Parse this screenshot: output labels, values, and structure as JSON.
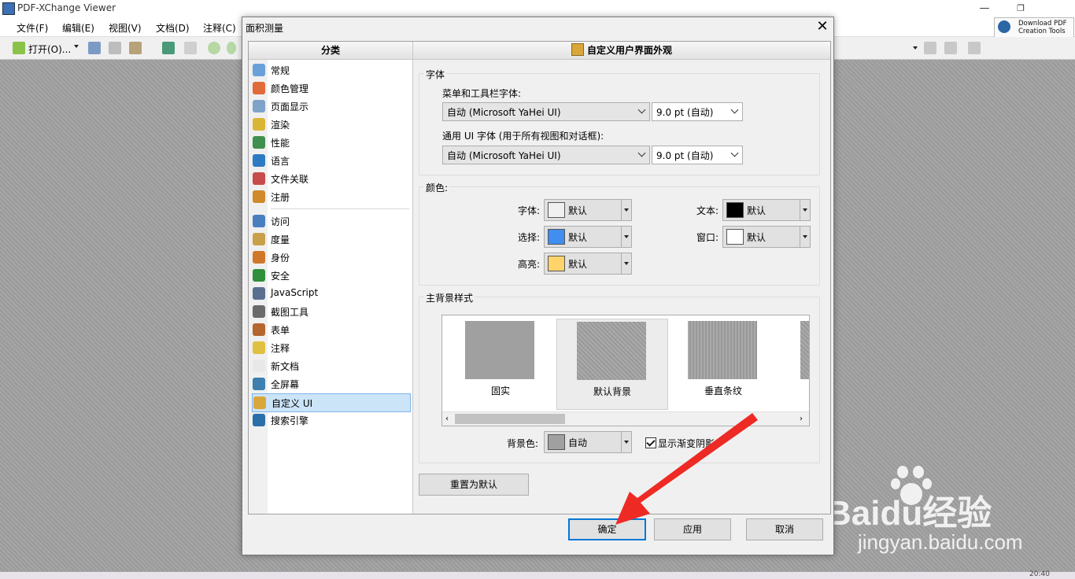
{
  "app": {
    "title": "PDF-XChange Viewer",
    "menus": [
      "文件(F)",
      "编辑(E)",
      "视图(V)",
      "文档(D)",
      "注释(C)"
    ],
    "toolbar_open": "打开(O)...",
    "download_tools": "Download PDF Creation Tools",
    "clock": "20:40"
  },
  "dialog": {
    "title": "面积测量",
    "left_header": "分类",
    "right_header": "自定义用户界面外观",
    "categories": [
      {
        "label": "常规",
        "icon": "general-icon",
        "color": "#6aa0d8"
      },
      {
        "label": "颜色管理",
        "icon": "color-management-icon",
        "color": "#e06a3a"
      },
      {
        "label": "页面显示",
        "icon": "page-display-icon",
        "color": "#7fa3c8"
      },
      {
        "label": "渲染",
        "icon": "render-icon",
        "color": "#d9b536"
      },
      {
        "label": "性能",
        "icon": "performance-icon",
        "color": "#3f8f4f"
      },
      {
        "label": "语言",
        "icon": "language-icon",
        "color": "#2e7bc4"
      },
      {
        "label": "文件关联",
        "icon": "file-association-icon",
        "color": "#c84b4b"
      },
      {
        "label": "注册",
        "icon": "register-icon",
        "color": "#d08a2a"
      },
      {
        "label": "访问",
        "icon": "access-icon",
        "color": "#4a7fbf"
      },
      {
        "label": "度量",
        "icon": "measure-icon",
        "color": "#c9a04a"
      },
      {
        "label": "身份",
        "icon": "identity-icon",
        "color": "#d0782a"
      },
      {
        "label": "安全",
        "icon": "security-icon",
        "color": "#2f8f3a"
      },
      {
        "label": "JavaScript",
        "icon": "javascript-icon",
        "color": "#5a6f8f"
      },
      {
        "label": "截图工具",
        "icon": "snapshot-icon",
        "color": "#6a6a6a"
      },
      {
        "label": "表单",
        "icon": "forms-icon",
        "color": "#b5652e"
      },
      {
        "label": "注释",
        "icon": "comments-icon",
        "color": "#e0c040"
      },
      {
        "label": "新文档",
        "icon": "new-document-icon",
        "color": "#e8e8e8"
      },
      {
        "label": "全屏幕",
        "icon": "fullscreen-icon",
        "color": "#3c7fb0"
      },
      {
        "label": "自定义 UI",
        "icon": "customize-ui-icon",
        "color": "#d9a63a"
      },
      {
        "label": "搜索引擎",
        "icon": "search-engine-icon",
        "color": "#2a6fa8"
      }
    ],
    "selected_category": "自定义 UI",
    "font_group": {
      "title": "字体",
      "menu_font_label": "菜单和工具栏字体:",
      "menu_font_value": "自动 (Microsoft YaHei UI)",
      "menu_font_size": "9.0 pt (自动)",
      "ui_font_label": "通用 UI 字体 (用于所有视图和对话框):",
      "ui_font_value": "自动 (Microsoft YaHei UI)",
      "ui_font_size": "9.0 pt (自动)"
    },
    "color_group": {
      "title": "颜色:",
      "font_label": "字体:",
      "font_value": "默认",
      "font_color": "#f0f0f0",
      "select_label": "选择:",
      "select_value": "默认",
      "select_color": "#3f8ef0",
      "highlight_label": "高亮:",
      "highlight_value": "默认",
      "highlight_color": "#ffd46a",
      "text_label": "文本:",
      "text_value": "默认",
      "text_color": "#000000",
      "window_label": "窗口:",
      "window_value": "默认",
      "window_color": "#ffffff"
    },
    "bg_group": {
      "title": "主背景样式",
      "tiles": [
        {
          "label": "固实",
          "style": "solid"
        },
        {
          "label": "默认背景",
          "style": "default"
        },
        {
          "label": "垂直条纹",
          "style": "vertical-stripes"
        }
      ],
      "bg_color_label": "背景色:",
      "bg_color_value": "自动",
      "bg_color": "#a0a0a0",
      "gradient_checkbox": "显示渐变阴影"
    },
    "reset_button": "重置为默认",
    "ok_button": "确定",
    "apply_button": "应用",
    "cancel_button": "取消"
  },
  "watermark": {
    "brand": "Baidu经验",
    "url": "jingyan.baidu.com"
  }
}
